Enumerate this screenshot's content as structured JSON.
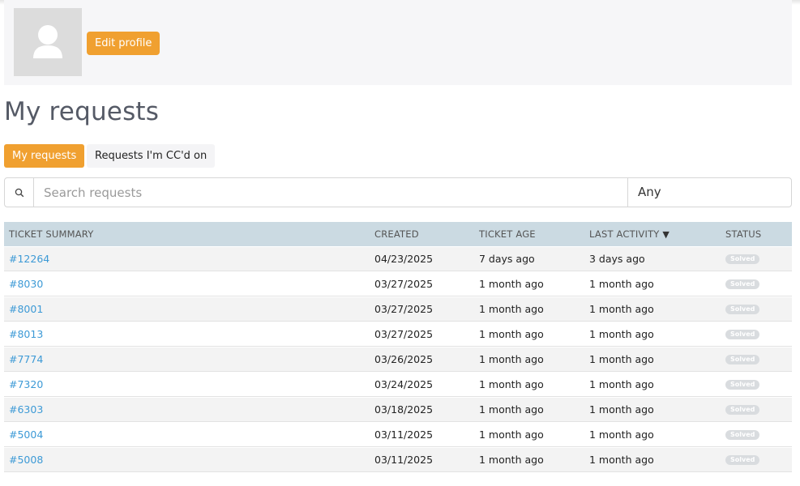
{
  "profile": {
    "edit_label": "Edit profile"
  },
  "page": {
    "title": "My requests"
  },
  "tabs": [
    {
      "label": "My requests",
      "active": true
    },
    {
      "label": "Requests I'm CC'd on",
      "active": false
    }
  ],
  "search": {
    "placeholder": "Search requests",
    "value": "",
    "filter_value": "Any"
  },
  "table": {
    "columns": {
      "ticket": "Ticket summary",
      "created": "Created",
      "age": "Ticket age",
      "last_activity": "Last activity",
      "status": "Status"
    },
    "sort_indicator": "▼",
    "rows": [
      {
        "ticket": "#12264",
        "created": "04/23/2025",
        "age": "7 days ago",
        "last": "3 days ago",
        "status": "Solved"
      },
      {
        "ticket": "#8030",
        "created": "03/27/2025",
        "age": "1 month ago",
        "last": "1 month ago",
        "status": "Solved"
      },
      {
        "ticket": "#8001",
        "created": "03/27/2025",
        "age": "1 month ago",
        "last": "1 month ago",
        "status": "Solved"
      },
      {
        "ticket": "#8013",
        "created": "03/27/2025",
        "age": "1 month ago",
        "last": "1 month ago",
        "status": "Solved"
      },
      {
        "ticket": "#7774",
        "created": "03/26/2025",
        "age": "1 month ago",
        "last": "1 month ago",
        "status": "Solved"
      },
      {
        "ticket": "#7320",
        "created": "03/24/2025",
        "age": "1 month ago",
        "last": "1 month ago",
        "status": "Solved"
      },
      {
        "ticket": "#6303",
        "created": "03/18/2025",
        "age": "1 month ago",
        "last": "1 month ago",
        "status": "Solved"
      },
      {
        "ticket": "#5004",
        "created": "03/11/2025",
        "age": "1 month ago",
        "last": "1 month ago",
        "status": "Solved"
      },
      {
        "ticket": "#5008",
        "created": "03/11/2025",
        "age": "1 month ago",
        "last": "1 month ago",
        "status": "Solved"
      }
    ]
  },
  "colors": {
    "accent": "#f0a030",
    "link": "#3d9ad6",
    "header_bg": "#cbdae2",
    "badge_bg": "#d9dcdf"
  },
  "icons": {
    "avatar": "user-silhouette-icon",
    "search": "search-icon",
    "sort": "sort-down-icon"
  }
}
